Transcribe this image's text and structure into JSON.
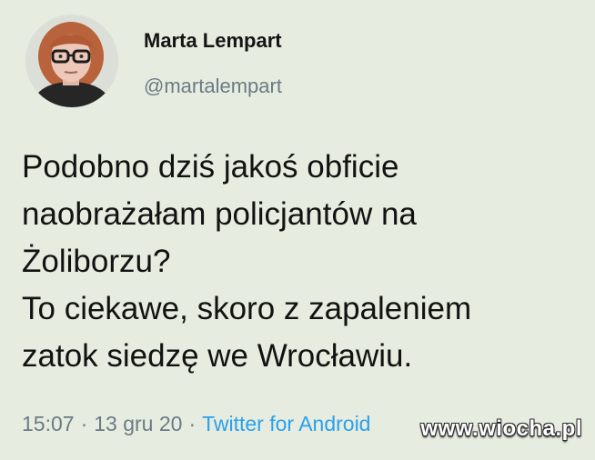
{
  "author": {
    "display_name": "Marta Lempart",
    "handle": "@martalempart"
  },
  "tweet": {
    "lines": [
      "Podobno dziś jakoś obficie",
      "naobrażałam policjantów na",
      "Żoliborzu?",
      "To ciekawe, skoro z zapaleniem",
      "zatok siedzę we Wrocławiu."
    ]
  },
  "meta": {
    "time": "15:07",
    "separator": "·",
    "date": "13 gru 20",
    "source": "Twitter for Android"
  },
  "watermark": "www.wiocha.pl",
  "colors": {
    "background": "#e6ecdf",
    "handle_gray": "#6c7a86",
    "link_blue": "#2aa1ec"
  }
}
